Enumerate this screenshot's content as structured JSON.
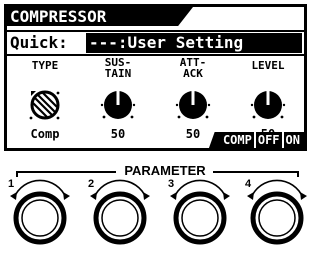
{
  "screen": {
    "title": "COMPRESSOR",
    "quick": {
      "label": "Quick:",
      "value": "---:User Setting"
    },
    "params": [
      {
        "label": "TYPE",
        "value": "Comp",
        "icon": "type-selector-icon"
      },
      {
        "label": "SUS-\nTAIN",
        "value": "50",
        "icon": "knob-icon"
      },
      {
        "label": "ATT-\nACK",
        "value": "50",
        "icon": "knob-icon"
      },
      {
        "label": "LEVEL",
        "value": "50",
        "icon": "knob-icon"
      }
    ],
    "status": {
      "comp": "COMP",
      "off": "OFF",
      "on": "ON"
    }
  },
  "hardware": {
    "parameter_label": "PARAMETER",
    "knobs": [
      {
        "number": "1"
      },
      {
        "number": "2"
      },
      {
        "number": "3"
      },
      {
        "number": "4"
      }
    ]
  },
  "colors": {
    "lcd_ink": "#000000",
    "lcd_background": "#ffffff"
  }
}
